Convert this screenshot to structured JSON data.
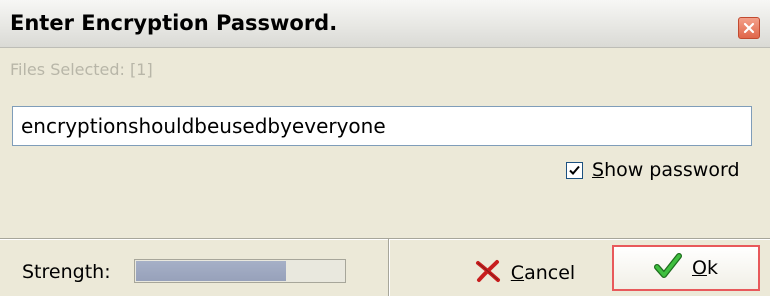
{
  "dialog": {
    "title": "Enter Encryption Password.",
    "files_selected": "Files Selected: [1]",
    "password_value": "encryptionshouldbeusedbyeveryone",
    "show_password": {
      "checked": true,
      "label_mnemonic": "S",
      "label_rest": "how password"
    },
    "strength": {
      "label": "Strength:",
      "level_fraction": 0.72
    },
    "buttons": {
      "cancel": {
        "mnemonic": "C",
        "rest": "ancel",
        "icon": "cancel-x-icon"
      },
      "ok": {
        "mnemonic": "O",
        "rest": "k",
        "icon": "checkmark-icon"
      }
    },
    "colors": {
      "accent_red": "#E8595B",
      "strength_fill": "#A6B0C7",
      "ok_check_green": "#2E9E2E",
      "cancel_x_red": "#C81E1E"
    }
  }
}
